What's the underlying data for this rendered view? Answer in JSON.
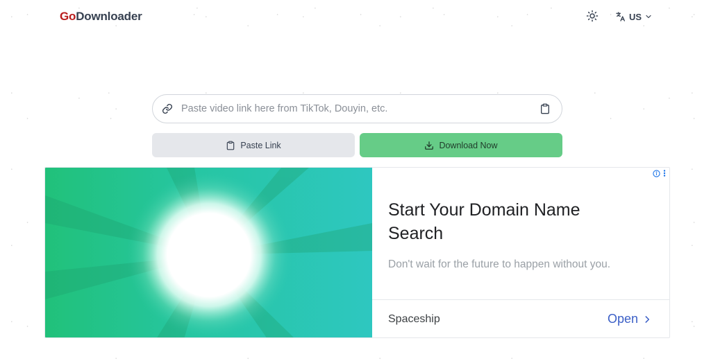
{
  "header": {
    "logo_go": "Go",
    "logo_rest": "Downloader",
    "language": "US"
  },
  "search": {
    "value": "",
    "placeholder": "Paste video link here from TikTok, Douyin, etc."
  },
  "actions": {
    "paste_label": "Paste Link",
    "download_label": "Download Now"
  },
  "ad": {
    "title": "Start Your Domain Name Search",
    "description": "Don't wait for the future to happen without you.",
    "advertiser": "Spaceship",
    "cta": "Open"
  },
  "colors": {
    "brand_red": "#b91c1c",
    "download_green": "#66cc87",
    "paste_gray": "#e5e7eb",
    "ad_link_blue": "#3b5fc7"
  },
  "icons": {
    "theme": "sun-icon",
    "language": "translate-icon",
    "chevron": "chevron-down-icon",
    "link": "link-icon",
    "clipboard": "clipboard-icon",
    "download": "download-icon",
    "ad_info": "info-icon",
    "ad_menu": "more-vertical-icon",
    "ad_open": "chevron-right-icon"
  }
}
